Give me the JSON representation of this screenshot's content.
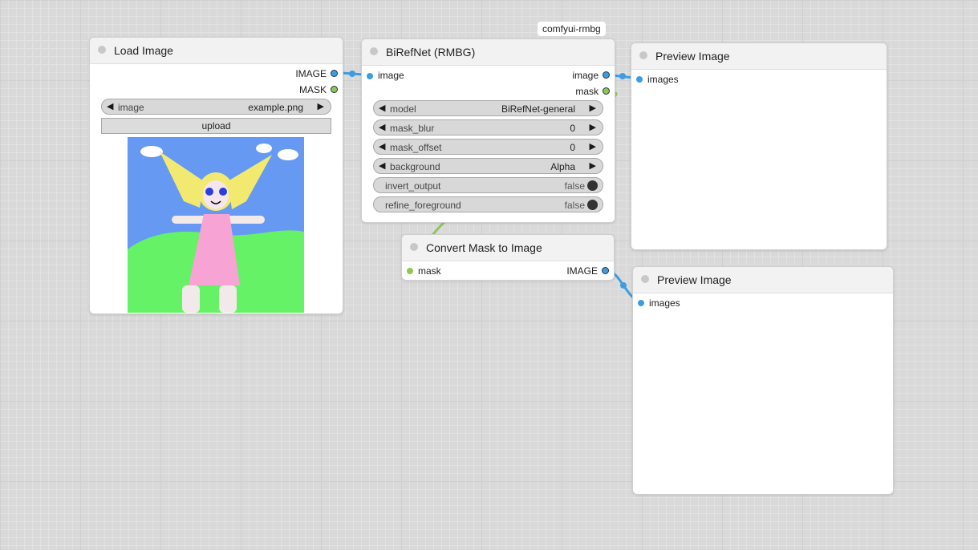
{
  "group": {
    "label": "comfyui-rmbg"
  },
  "load_image": {
    "title": "Load Image",
    "outputs": [
      "IMAGE",
      "MASK"
    ],
    "widget": {
      "name": "image",
      "value": "example.png"
    },
    "upload_label": "upload"
  },
  "birefnet": {
    "title": "BiRefNet (RMBG)",
    "input": "image",
    "outputs": [
      "image",
      "mask"
    ],
    "widgets": [
      {
        "name": "model",
        "value": "BiRefNet-general"
      },
      {
        "name": "mask_blur",
        "value": "0"
      },
      {
        "name": "mask_offset",
        "value": "0"
      },
      {
        "name": "background",
        "value": "Alpha"
      }
    ],
    "toggles": [
      {
        "name": "invert_output",
        "value": "false"
      },
      {
        "name": "refine_foreground",
        "value": "false"
      }
    ]
  },
  "convert_mask": {
    "title": "Convert Mask to Image",
    "input": "mask",
    "output": "IMAGE"
  },
  "preview_1": {
    "title": "Preview Image",
    "input": "images"
  },
  "preview_2": {
    "title": "Preview Image",
    "input": "images"
  },
  "colors": {
    "image_link": "#3d9de0",
    "mask_link": "#8fc755",
    "canvas": "#d9d9d9"
  }
}
